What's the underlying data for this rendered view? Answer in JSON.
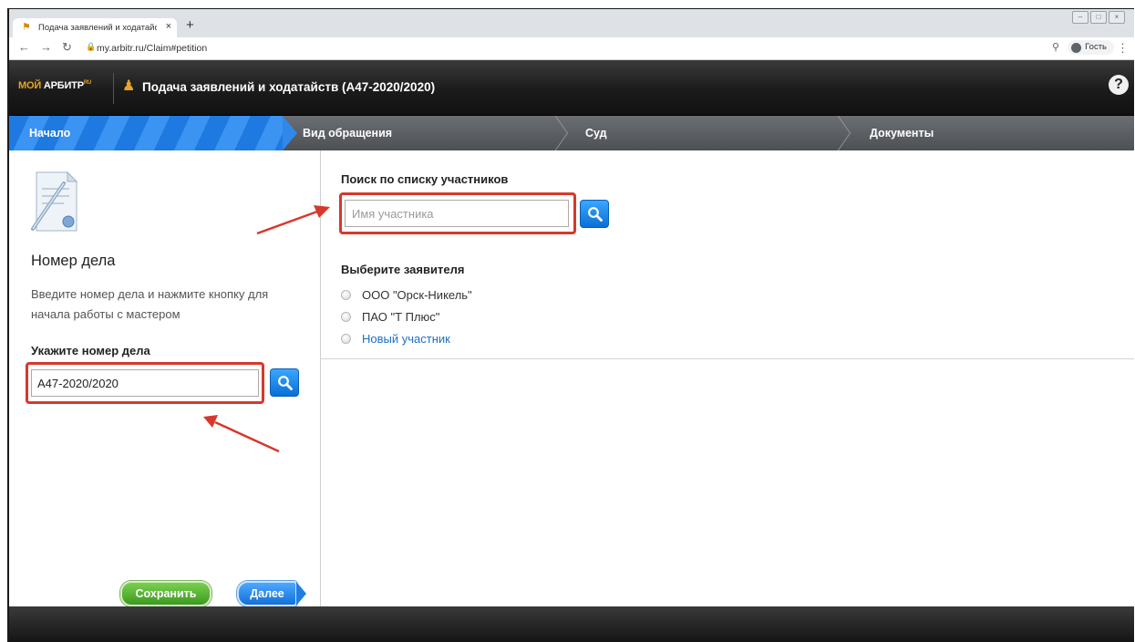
{
  "browser": {
    "tab_title": "Подача заявлений и ходатайст",
    "tab_close": "×",
    "new_tab": "+",
    "url": "my.arbitr.ru/Claim#petition",
    "profile_label": "Гость",
    "window_buttons": [
      "–",
      "□",
      "×"
    ]
  },
  "app": {
    "logo_moi": "МОЙ",
    "logo_arbitr": " АРБИТР",
    "logo_ru": "RU",
    "title": "Подача заявлений и ходатайств  (А47-2020/2020)",
    "help": "?"
  },
  "steps": [
    {
      "label": "Начало",
      "active": true
    },
    {
      "label": "Вид обращения",
      "active": false
    },
    {
      "label": "Суд",
      "active": false
    },
    {
      "label": "Документы",
      "active": false
    }
  ],
  "left": {
    "heading": "Номер дела",
    "description": "Введите номер дела и нажмите кнопку для начала работы с мастером",
    "case_label": "Укажите номер дела",
    "case_value": "А47-2020/2020",
    "save_button": "Сохранить",
    "next_button": "Далее"
  },
  "right": {
    "search_label": "Поиск по списку участников",
    "search_placeholder": "Имя участника",
    "search_value": "",
    "choose_label": "Выберите заявителя",
    "applicants": [
      {
        "label": "ООО \"Орск-Никель\"",
        "selected": false
      },
      {
        "label": "ПАО \"Т Плюс\"",
        "selected": false
      },
      {
        "label": "Новый участник",
        "selected": false
      }
    ]
  },
  "colors": {
    "accent_blue": "#1e7ae0",
    "save_green": "#3b9a1f",
    "highlight_red": "#d6392b",
    "link_blue": "#1a6fc7"
  }
}
